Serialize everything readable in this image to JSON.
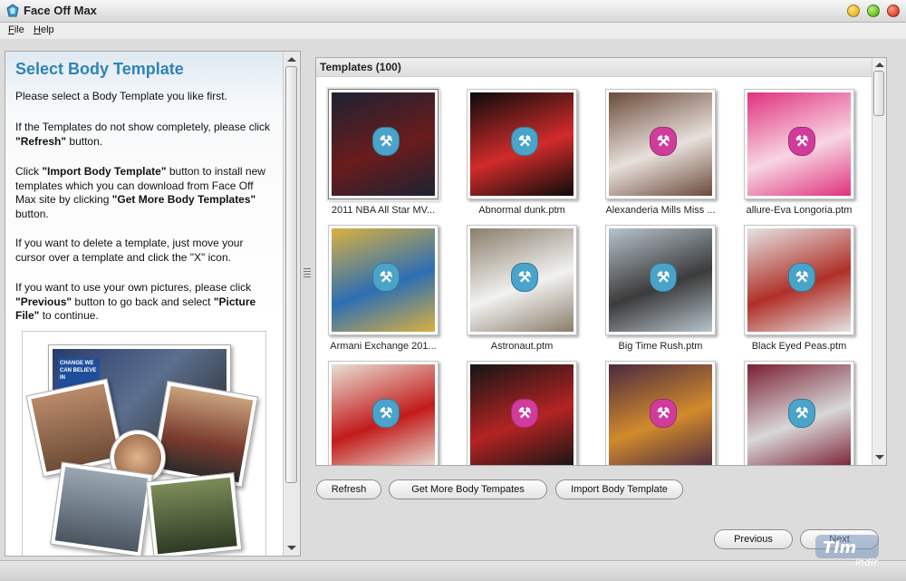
{
  "window": {
    "title": "Face Off Max"
  },
  "menu": {
    "file": "File",
    "help": "Help"
  },
  "left": {
    "title": "Select Body Template",
    "p1": "Please select a Body Template you like first.",
    "p2_a": "If the Templates do not show completely, please click ",
    "p2_b": "\"Refresh\"",
    "p2_c": " button.",
    "p3_a": "Click ",
    "p3_b": "\"Import Body Template\"",
    "p3_c": " button to install new templates which you can download from Face Off Max site by clicking ",
    "p3_d": "\"Get More Body Templates\"",
    "p3_e": " button.",
    "p4": "If you want to delete a template, just move your cursor over a template and click the \"X\" icon.",
    "p5_a": "If you want to use your own pictures, please click ",
    "p5_b": "\"Previous\"",
    "p5_c": " button to go back and select ",
    "p5_d": "\"Picture File\"",
    "p5_e": " to continue.",
    "collage_sign": "CHANGE WE CAN BELIEVE IN"
  },
  "templates": {
    "header": "Templates (100)",
    "items": [
      {
        "label": "2011 NBA All Star MV...",
        "bg": "#1d2233",
        "accent": "#6a1c1c",
        "mask": "#4aa3c8"
      },
      {
        "label": "Abnormal dunk.ptm",
        "bg": "#0b0b0b",
        "accent": "#d22b2b",
        "mask": "#4aa3c8"
      },
      {
        "label": "Alexanderia Mills Miss ...",
        "bg": "#6b4b3a",
        "accent": "#e8e0dc",
        "mask": "#d13c9c"
      },
      {
        "label": "allure-Eva Longoria.ptm",
        "bg": "#e0317d",
        "accent": "#f7d6e2",
        "mask": "#d13c9c"
      },
      {
        "label": "Armani Exchange 201...",
        "bg": "#d9b040",
        "accent": "#2d6fb4",
        "mask": "#4aa3c8"
      },
      {
        "label": "Astronaut.ptm",
        "bg": "#8a7d6a",
        "accent": "#f2f2f2",
        "mask": "#4aa3c8"
      },
      {
        "label": "Big Time Rush.ptm",
        "bg": "#b7c3cc",
        "accent": "#3b3b3b",
        "mask": "#4aa3c8"
      },
      {
        "label": "Black Eyed Peas.ptm",
        "bg": "#e4e4e4",
        "accent": "#b03028",
        "mask": "#4aa3c8"
      },
      {
        "label": "",
        "bg": "#e8e0d5",
        "accent": "#c21b1b",
        "mask": "#4aa3c8"
      },
      {
        "label": "",
        "bg": "#151515",
        "accent": "#b52323",
        "mask": "#d13c9c"
      },
      {
        "label": "",
        "bg": "#4a2a40",
        "accent": "#d28a2c",
        "mask": "#d13c9c"
      },
      {
        "label": "",
        "bg": "#7a1f33",
        "accent": "#d8d8d8",
        "mask": "#4aa3c8"
      }
    ]
  },
  "buttons": {
    "refresh": "Refresh",
    "get_more": "Get More Body Tempates",
    "import": "Import Body Template",
    "previous": "Previous",
    "next": "Next"
  }
}
